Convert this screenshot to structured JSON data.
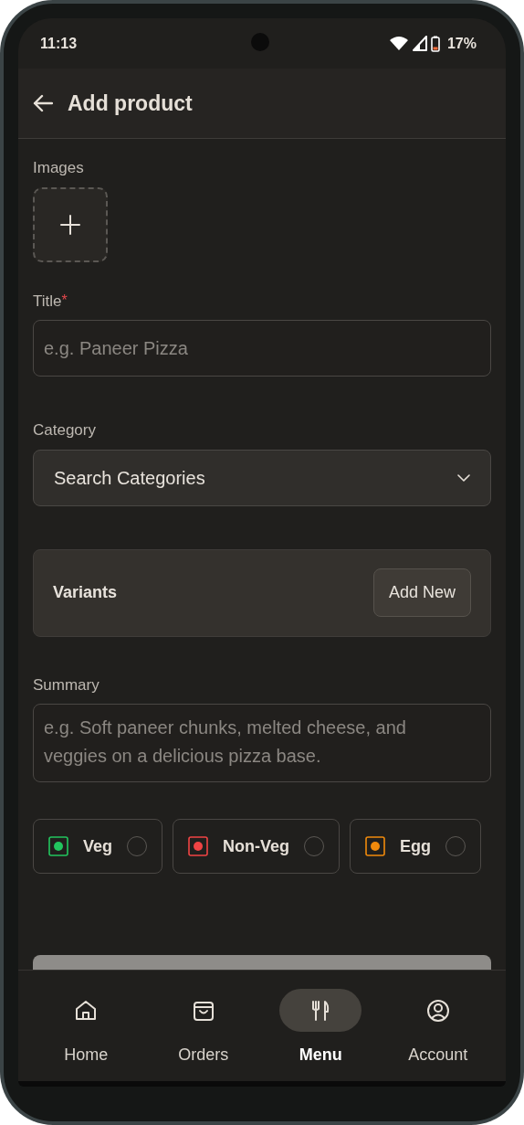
{
  "status_bar": {
    "time": "11:13",
    "battery": "17%"
  },
  "header": {
    "title": "Add product"
  },
  "images": {
    "label": "Images"
  },
  "title_field": {
    "label": "Title",
    "required_mark": "*",
    "placeholder": "e.g. Paneer Pizza"
  },
  "category": {
    "label": "Category",
    "placeholder": "Search Categories"
  },
  "variants": {
    "label": "Variants",
    "button": "Add New"
  },
  "summary": {
    "label": "Summary",
    "placeholder": "e.g. Soft paneer chunks, melted cheese, and veggies on a delicious pizza base."
  },
  "diet_options": [
    {
      "label": "Veg",
      "color": "#22c55e",
      "selected": false
    },
    {
      "label": "Non-Veg",
      "color": "#ef4444",
      "selected": false
    },
    {
      "label": "Egg",
      "color": "#f08a0c",
      "selected": false
    }
  ],
  "nav": {
    "items": [
      {
        "kind": "home",
        "label": "Home",
        "selected": false
      },
      {
        "kind": "orders",
        "label": "Orders",
        "selected": false
      },
      {
        "kind": "menu",
        "label": "Menu",
        "selected": true
      },
      {
        "kind": "account",
        "label": "Account",
        "selected": false
      }
    ]
  }
}
